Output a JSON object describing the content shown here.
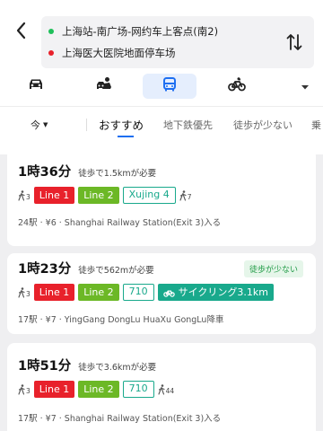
{
  "route": {
    "from": "上海站-南广场-网约车上客点(南2)",
    "to": "上海医大医院地面停车场"
  },
  "modes": [
    {
      "name": "car-icon"
    },
    {
      "name": "taxi-icon"
    },
    {
      "name": "bus-icon",
      "selected": true
    },
    {
      "name": "bike-icon"
    },
    {
      "name": "chevron-down-icon"
    }
  ],
  "filters": {
    "time": "今",
    "recommended": "おすすめ",
    "subway": "地下鉄優先",
    "less_walk": "徒歩が少ない",
    "more": "乗"
  },
  "colors": {
    "accent": "#1e6ff1",
    "line1": "#e8212b",
    "line2": "#6cb826",
    "teal": "#19a98c",
    "badge_bg": "#e6f6ea",
    "badge_text": "#1f9a45"
  },
  "routes": [
    {
      "duration": "1時36分",
      "walk": "徒歩で1.5kmが必要",
      "segments": {
        "walk_start": "3",
        "line1": "Line 1",
        "line2": "Line 2",
        "line3": "Xujing 4",
        "walk_end": "7"
      },
      "info": "24駅 · ¥6 · Shanghai Railway Station(Exit 3)入る"
    },
    {
      "duration": "1時23分",
      "walk": "徒歩で562mが必要",
      "badge": "徒歩が少ない",
      "segments": {
        "walk_start": "3",
        "line1": "Line 1",
        "line2": "Line 2",
        "line3": "710",
        "cycle": "サイクリング3.1km"
      },
      "info": "17駅 · ¥7 · YingGang DongLu HuaXu GongLu降車"
    },
    {
      "duration": "1時51分",
      "walk": "徒歩で3.6kmが必要",
      "segments": {
        "walk_start": "3",
        "line1": "Line 1",
        "line2": "Line 2",
        "line3": "710",
        "walk_end": "44"
      },
      "info": "17駅 · ¥7 · Shanghai Railway Station(Exit 3)入る"
    }
  ]
}
